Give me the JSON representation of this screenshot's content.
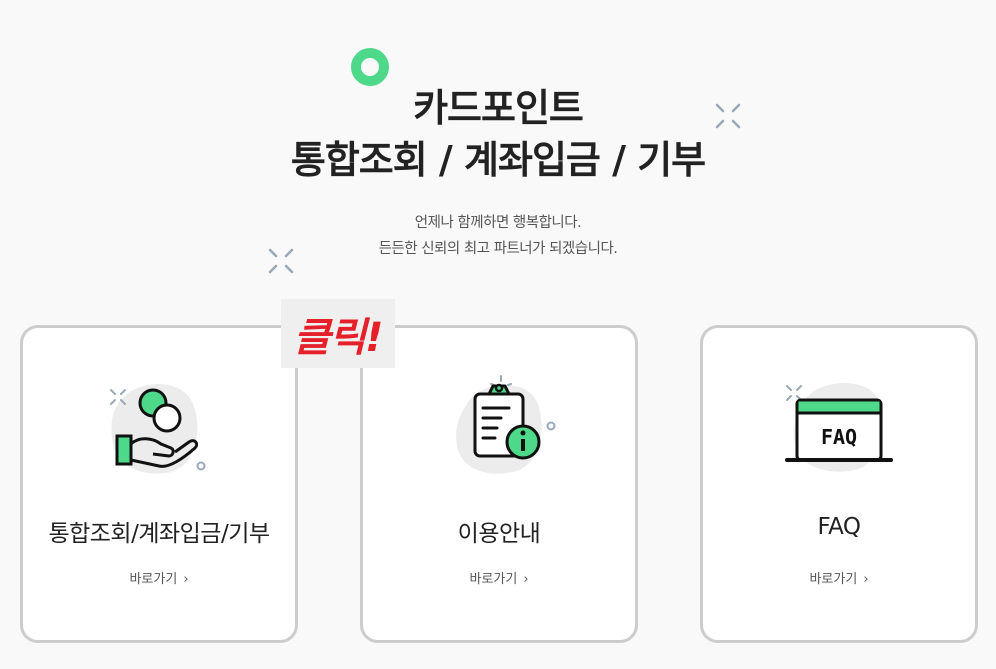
{
  "header": {
    "title_line1": "카드포인트",
    "title_line2": "통합조회 / 계좌입금 / 기부",
    "subtitle_line1": "언제나 함께하면 행복합니다.",
    "subtitle_line2": "든든한 신뢰의 최고 파트너가 되겠습니다."
  },
  "click_badge": "클릭!",
  "cards": [
    {
      "title": "통합조회/계좌입금/기부",
      "link": "바로가기",
      "icon": "hand-coins-icon"
    },
    {
      "title": "이용안내",
      "link": "바로가기",
      "icon": "clipboard-info-icon"
    },
    {
      "title": "FAQ",
      "link": "바로가기",
      "icon": "faq-icon",
      "icon_text": "FAQ"
    }
  ],
  "colors": {
    "accent": "#4ed98a",
    "badge_text": "#e5202a",
    "card_border": "#cccccc"
  }
}
